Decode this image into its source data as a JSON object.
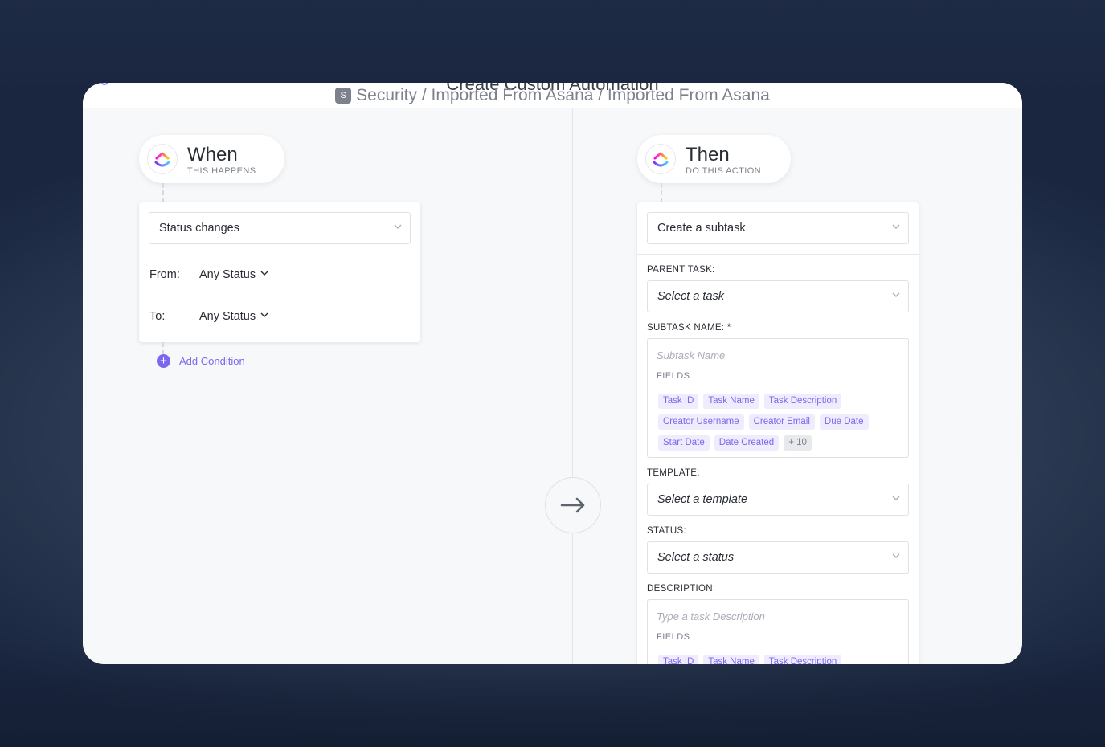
{
  "modal": {
    "cut_title": "Create Custom Automation",
    "breadcrumb": {
      "badge": "S",
      "path": "Security / Imported From Asana / Imported From Asana"
    }
  },
  "when": {
    "title": "When",
    "subtitle": "THIS HAPPENS",
    "trigger": "Status changes",
    "from_label": "From:",
    "from_value": "Any Status",
    "to_label": "To:",
    "to_value": "Any Status",
    "add_condition": "Add Condition"
  },
  "then": {
    "title": "Then",
    "subtitle": "DO THIS ACTION",
    "action": "Create a subtask",
    "parent_task": {
      "label": "PARENT TASK:",
      "value": "Select a task"
    },
    "subtask_name": {
      "label": "SUBTASK NAME: *",
      "placeholder": "Subtask Name",
      "fields_label": "FIELDS",
      "tags": [
        "Task ID",
        "Task Name",
        "Task Description",
        "Creator Username",
        "Creator Email",
        "Due Date",
        "Start Date",
        "Date Created"
      ],
      "more": "+ 10"
    },
    "template": {
      "label": "TEMPLATE:",
      "value": "Select a template"
    },
    "status": {
      "label": "STATUS:",
      "value": "Select a status"
    },
    "description": {
      "label": "DESCRIPTION:",
      "placeholder": "Type a task Description",
      "fields_label": "FIELDS",
      "tags": [
        "Task ID",
        "Task Name",
        "Task Description"
      ]
    }
  },
  "icons": [
    "clickup-logo-icon",
    "chevron-down-icon",
    "arrow-right-icon",
    "plus-circle-icon"
  ],
  "colors": {
    "accent": "#7b68ee",
    "tag_bg": "#eeecfd",
    "text": "#292d34",
    "muted": "#7c828d"
  }
}
